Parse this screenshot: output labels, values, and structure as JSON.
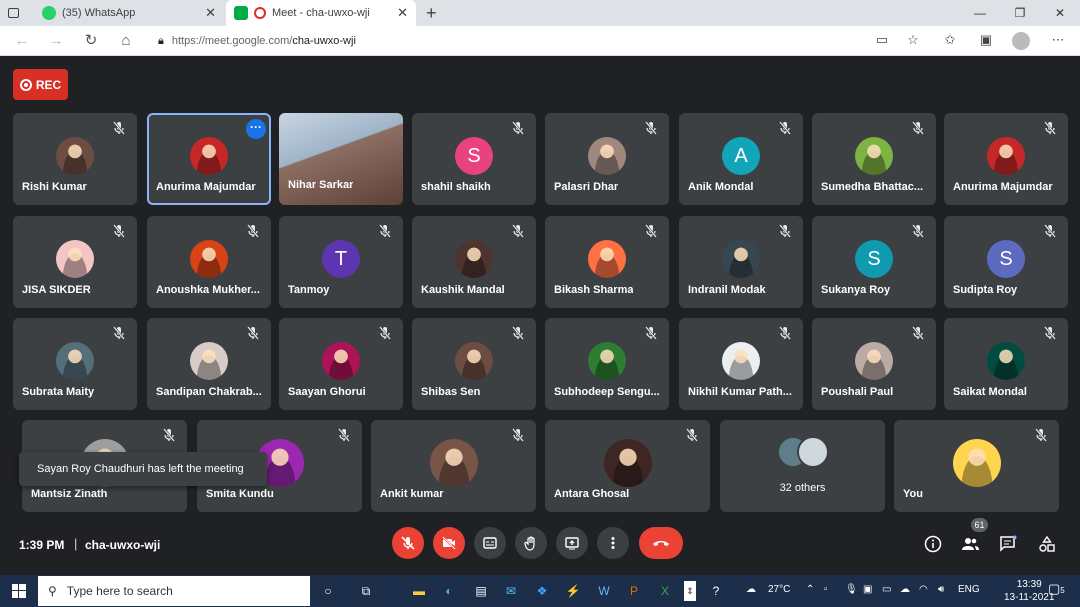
{
  "browser": {
    "tabs": [
      {
        "title": "(35) WhatsApp"
      },
      {
        "title": "Meet - cha-uwxo-wji"
      }
    ],
    "url_prefix": "https://meet.google.com/",
    "url_path": "cha-uwxo-wji"
  },
  "meet": {
    "rec_label": "REC",
    "tiles": [
      {
        "name": "Rishi Kumar",
        "avatar": "photo",
        "color": "#6d4c41"
      },
      {
        "name": "Anurima Majumdar",
        "avatar": "photo",
        "color": "#c62828",
        "selected": true
      },
      {
        "name": "Nihar Sarkar",
        "avatar": "video",
        "color": "#8d6e63"
      },
      {
        "name": "shahil shaikh",
        "avatar": "S",
        "color": "#e8437f"
      },
      {
        "name": "Palasri Dhar",
        "avatar": "photo",
        "color": "#a1887f"
      },
      {
        "name": "Anik Mondal",
        "avatar": "A",
        "color": "#12a4b8"
      },
      {
        "name": "Sumedha Bhattac...",
        "avatar": "photo",
        "color": "#7cb342"
      },
      {
        "name": "Anurima Majumdar",
        "avatar": "photo",
        "color": "#c62828"
      },
      {
        "name": "JISA SIKDER",
        "avatar": "photo",
        "color": "#f3c5c5"
      },
      {
        "name": "Anoushka Mukher...",
        "avatar": "photo",
        "color": "#d84315"
      },
      {
        "name": "Tanmoy",
        "avatar": "T",
        "color": "#5e35b1"
      },
      {
        "name": "Kaushik Mandal",
        "avatar": "photo",
        "color": "#4e342e"
      },
      {
        "name": "Bikash Sharma",
        "avatar": "photo",
        "color": "#ff7043"
      },
      {
        "name": "Indranil Modak",
        "avatar": "photo",
        "color": "#37474f"
      },
      {
        "name": "Sukanya Roy",
        "avatar": "S",
        "color": "#0f9ab0"
      },
      {
        "name": "Sudipta Roy",
        "avatar": "S",
        "color": "#5c6bc0"
      },
      {
        "name": "Subrata Maity",
        "avatar": "photo",
        "color": "#546e7a"
      },
      {
        "name": "Sandipan Chakrab...",
        "avatar": "photo",
        "color": "#d7ccc8"
      },
      {
        "name": "Saayan Ghorui",
        "avatar": "photo",
        "color": "#ad1457"
      },
      {
        "name": "Shibas Sen",
        "avatar": "photo",
        "color": "#6d4c41"
      },
      {
        "name": "Subhodeep Sengu...",
        "avatar": "photo",
        "color": "#2e7d32"
      },
      {
        "name": "Nikhil Kumar Path...",
        "avatar": "photo",
        "color": "#eceff1"
      },
      {
        "name": "Poushali Paul",
        "avatar": "photo",
        "color": "#bcaaa4"
      },
      {
        "name": "Saikat Mondal",
        "avatar": "photo",
        "color": "#004d40"
      },
      {
        "name": "Mantsiz Zinath",
        "avatar": "photo",
        "color": "#9e9e9e"
      },
      {
        "name": "Smita Kundu",
        "avatar": "photo",
        "color": "#9c27b0"
      },
      {
        "name": "Ankit kumar",
        "avatar": "photo",
        "color": "#795548"
      },
      {
        "name": "Antara Ghosal",
        "avatar": "photo",
        "color": "#3e2723"
      },
      {
        "name": "32 others",
        "avatar": "group",
        "color": "#607d8b"
      },
      {
        "name": "You",
        "avatar": "photo",
        "color": "#ffd54f"
      }
    ],
    "toast": "Sayan Roy Chaudhuri has left the meeting",
    "time": "1:39 PM",
    "meeting_code": "cha-uwxo-wji",
    "participants_count": "61"
  },
  "taskbar": {
    "search_placeholder": "Type here to search",
    "weather": "27°C",
    "lang": "ENG",
    "time": "13:39",
    "date": "13-11-2021",
    "notif_count": "5"
  }
}
